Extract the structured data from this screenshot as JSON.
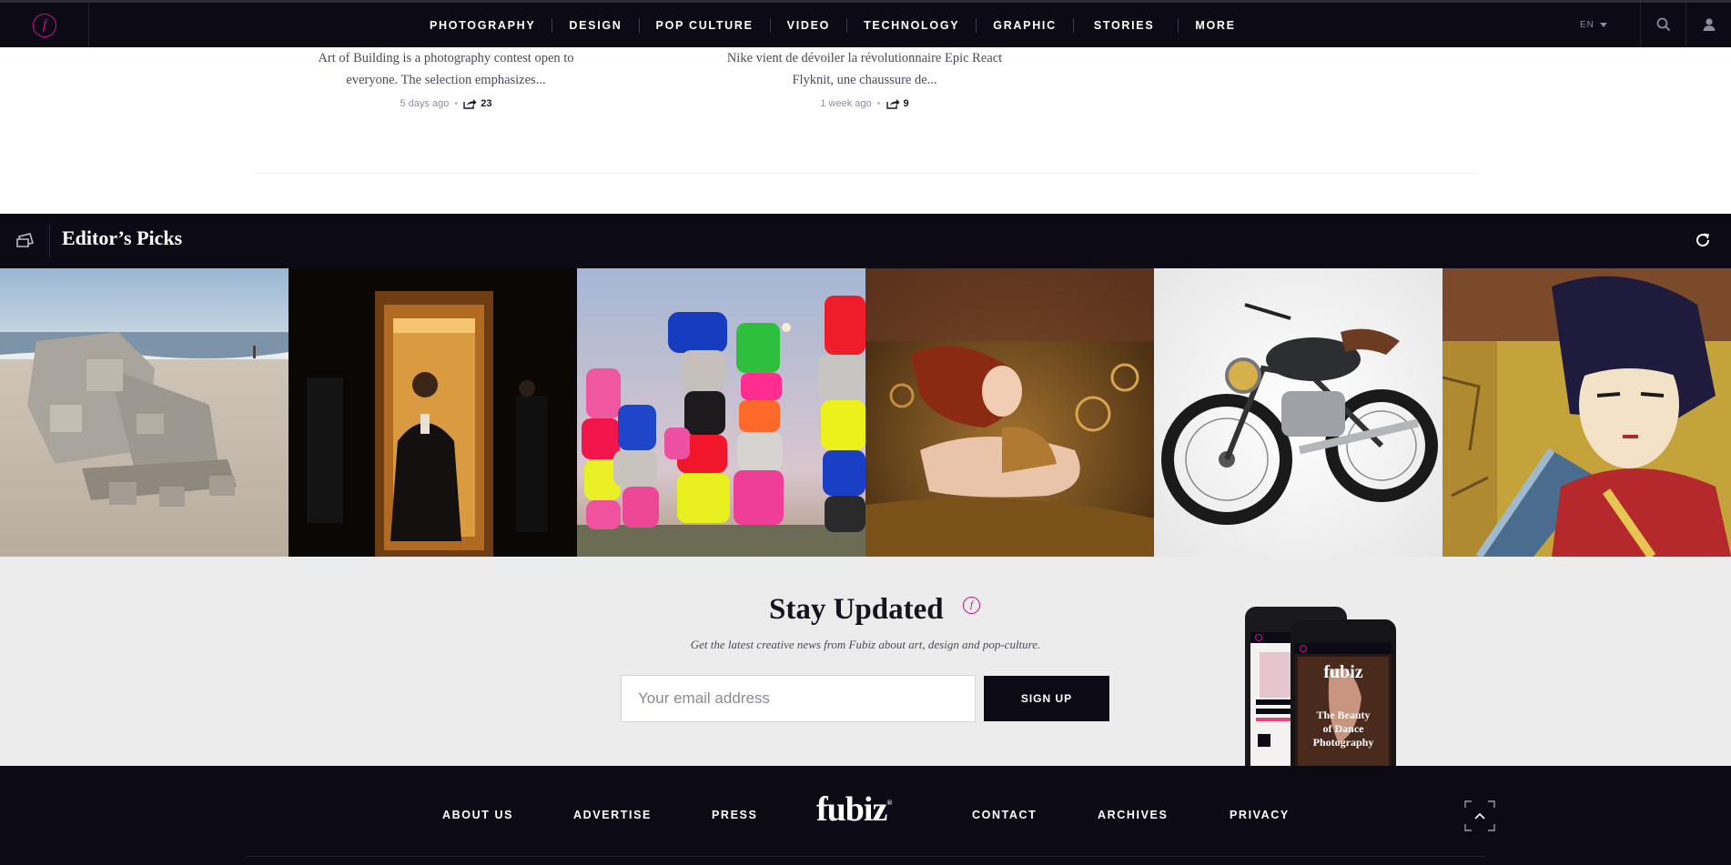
{
  "nav": {
    "logo_letter": "f",
    "items": [
      "PHOTOGRAPHY",
      "DESIGN",
      "POP CULTURE",
      "VIDEO",
      "TECHNOLOGY",
      "GRAPHIC",
      "STORIES",
      "MORE"
    ],
    "language": "EN"
  },
  "articles": [
    {
      "excerpt_line1": "Art of Building is a photography contest open to",
      "excerpt_line2": "everyone. The selection emphasizes...",
      "time": "5 days ago",
      "shares": "23"
    },
    {
      "excerpt_line1": "Nike vient de dévoiler la révolutionnaire Epic React",
      "excerpt_line2": "Flyknit, une chaussure de...",
      "time": "1 week ago",
      "shares": "9"
    }
  ],
  "editors_picks": {
    "title": "Editor’s Picks",
    "images": [
      "sand-architecture",
      "man-in-elevator",
      "colorful-stacked-rocks",
      "woman-in-gold",
      "custom-motorcycle",
      "anime-warrior"
    ]
  },
  "newsletter": {
    "title": "Stay Updated",
    "badge_letter": "f",
    "subtitle": "Get the latest creative news from Fubiz about art, design and pop-culture.",
    "email_placeholder": "Your email address",
    "signup_label": "SIGN UP",
    "phone_headline": "The Beauty of Dance Photography",
    "phone_brand": "fubiz"
  },
  "footer": {
    "links": [
      "ABOUT US",
      "ADVERTISE",
      "PRESS",
      "CONTACT",
      "ARCHIVES",
      "PRIVACY"
    ],
    "logo": "fubiz",
    "logo_mark": "®"
  },
  "colors": {
    "dark": "#0c0b15",
    "accent": "#c2148a",
    "newsletter_bg": "#ececec"
  }
}
